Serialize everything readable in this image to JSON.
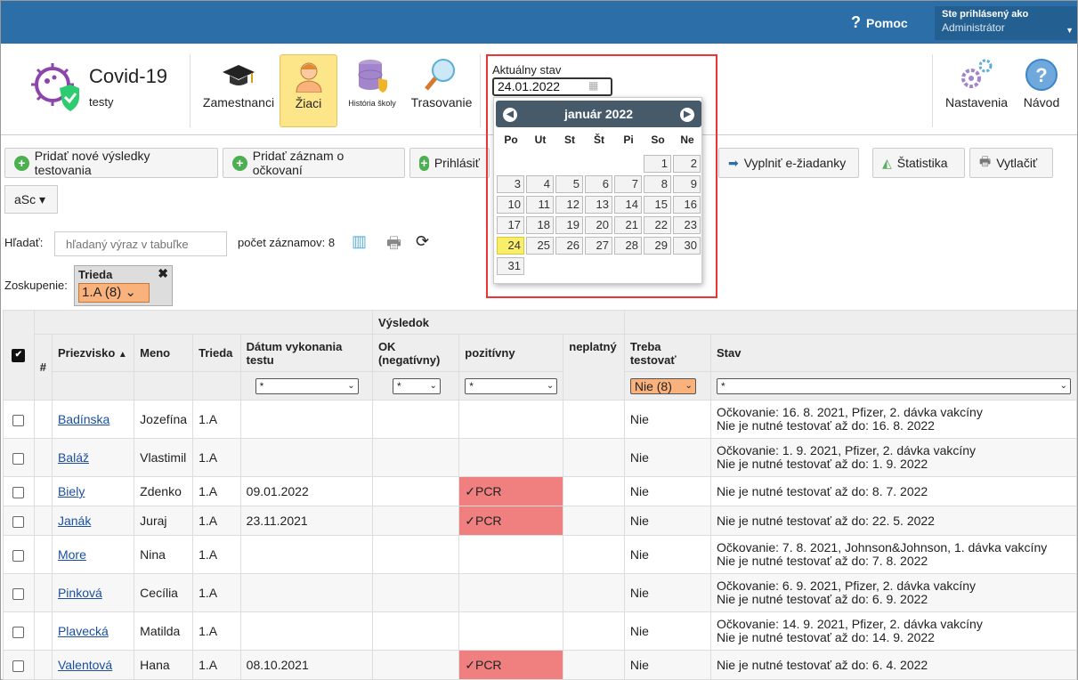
{
  "topbar": {
    "help": "Pomoc",
    "user_title": "Ste prihlásený ako",
    "user_role": "Administrátor"
  },
  "app": {
    "title": "Covid-19",
    "subtitle": "testy"
  },
  "nav": [
    {
      "label": "Zamestnanci",
      "icon": "graduation-cap-icon"
    },
    {
      "label": "Žiaci",
      "icon": "student-icon",
      "active": true
    },
    {
      "label": "História školy",
      "icon": "database-icon"
    },
    {
      "label": "Trasovanie",
      "icon": "magnifier-icon"
    },
    {
      "label": "Nastavenia",
      "icon": "gears-icon"
    },
    {
      "label": "Návod",
      "icon": "help-circle-icon"
    }
  ],
  "datepicker": {
    "label": "Aktuálny stav",
    "value": "24.01.2022",
    "month_title": "január 2022",
    "dow": [
      "Po",
      "Ut",
      "St",
      "Št",
      "Pi",
      "So",
      "Ne"
    ],
    "days": [
      "1",
      "2",
      "3",
      "4",
      "5",
      "6",
      "7",
      "8",
      "9",
      "10",
      "11",
      "12",
      "13",
      "14",
      "15",
      "16",
      "17",
      "18",
      "19",
      "20",
      "21",
      "22",
      "23",
      "24",
      "25",
      "26",
      "27",
      "28",
      "29",
      "30",
      "31"
    ],
    "first_weekday_index": 5,
    "today": "24"
  },
  "toolbar": {
    "add_results": "Pridať nové výsledky testovania",
    "add_vaccination": "Pridať záznam o očkovaní",
    "login": "Prihlásiť",
    "fill": "Vyplniť e-žiadanky",
    "stats": "Štatistika",
    "print": "Vytlačiť",
    "asc": "aSc ▾"
  },
  "search": {
    "label": "Hľadať:",
    "placeholder": "hľadaný výraz v tabuľke",
    "count": "počet záznamov: 8"
  },
  "grouping": {
    "label": "Zoskupenie:",
    "chip_title": "Trieda",
    "chip_value": "1.A (8)"
  },
  "table": {
    "group_header": "Výsledok",
    "headers": {
      "num": "#",
      "surname": "Priezvisko",
      "name": "Meno",
      "class": "Trieda",
      "date": "Dátum vykonania testu",
      "ok": "OK (negatívny)",
      "positive": "pozitívny",
      "invalid": "neplatný",
      "need": "Treba testovať",
      "status": "Stav"
    },
    "filters": {
      "date": "*",
      "ok": "*",
      "positive": "*",
      "need": "Nie (8)",
      "status": "*"
    },
    "rows": [
      {
        "surname": "Badínska",
        "name": "Jozefína",
        "class": "1.A",
        "date": "",
        "positive": "",
        "need": "Nie",
        "status1": "Očkovanie: 16. 8. 2021, Pfizer, 2. dávka vakcíny",
        "status2": "Nie je nutné testovať až do: 16. 8. 2022"
      },
      {
        "surname": "Baláž",
        "name": "Vlastimil",
        "class": "1.A",
        "date": "",
        "positive": "",
        "need": "Nie",
        "status1": "Očkovanie: 1. 9. 2021, Pfizer, 2. dávka vakcíny",
        "status2": "Nie je nutné testovať až do: 1. 9. 2022"
      },
      {
        "surname": "Biely",
        "name": "Zdenko",
        "class": "1.A",
        "date": "09.01.2022",
        "positive": "✓PCR",
        "need": "Nie",
        "status1": "Nie je nutné testovať až do: 8. 7. 2022",
        "status2": ""
      },
      {
        "surname": "Janák",
        "name": "Juraj",
        "class": "1.A",
        "date": "23.11.2021",
        "positive": "✓PCR",
        "need": "Nie",
        "status1": "Nie je nutné testovať až do: 22. 5. 2022",
        "status2": ""
      },
      {
        "surname": "More",
        "name": "Nina",
        "class": "1.A",
        "date": "",
        "positive": "",
        "need": "Nie",
        "status1": "Očkovanie: 7. 8. 2021, Johnson&Johnson, 1. dávka vakcíny",
        "status2": "Nie je nutné testovať až do: 7. 8. 2022"
      },
      {
        "surname": "Pinková",
        "name": "Cecília",
        "class": "1.A",
        "date": "",
        "positive": "",
        "need": "Nie",
        "status1": "Očkovanie: 6. 9. 2021, Pfizer, 2. dávka vakcíny",
        "status2": "Nie je nutné testovať až do: 6. 9. 2022"
      },
      {
        "surname": "Plavecká",
        "name": "Matilda",
        "class": "1.A",
        "date": "",
        "positive": "",
        "need": "Nie",
        "status1": "Očkovanie: 14. 9. 2021, Pfizer, 2. dávka vakcíny",
        "status2": "Nie je nutné testovať až do: 14. 9. 2022"
      },
      {
        "surname": "Valentová",
        "name": "Hana",
        "class": "1.A",
        "date": "08.10.2021",
        "positive": "✓PCR",
        "need": "Nie",
        "status1": "Nie je nutné testovať až do: 6. 4. 2022",
        "status2": ""
      }
    ]
  },
  "colors": {
    "topbar": "#2b6ea8",
    "active_nav": "#fde68a",
    "positive": "#f08080",
    "filter_orange": "#f9b27b",
    "calendar_header": "#465a6a",
    "today": "#f8ee6a"
  }
}
